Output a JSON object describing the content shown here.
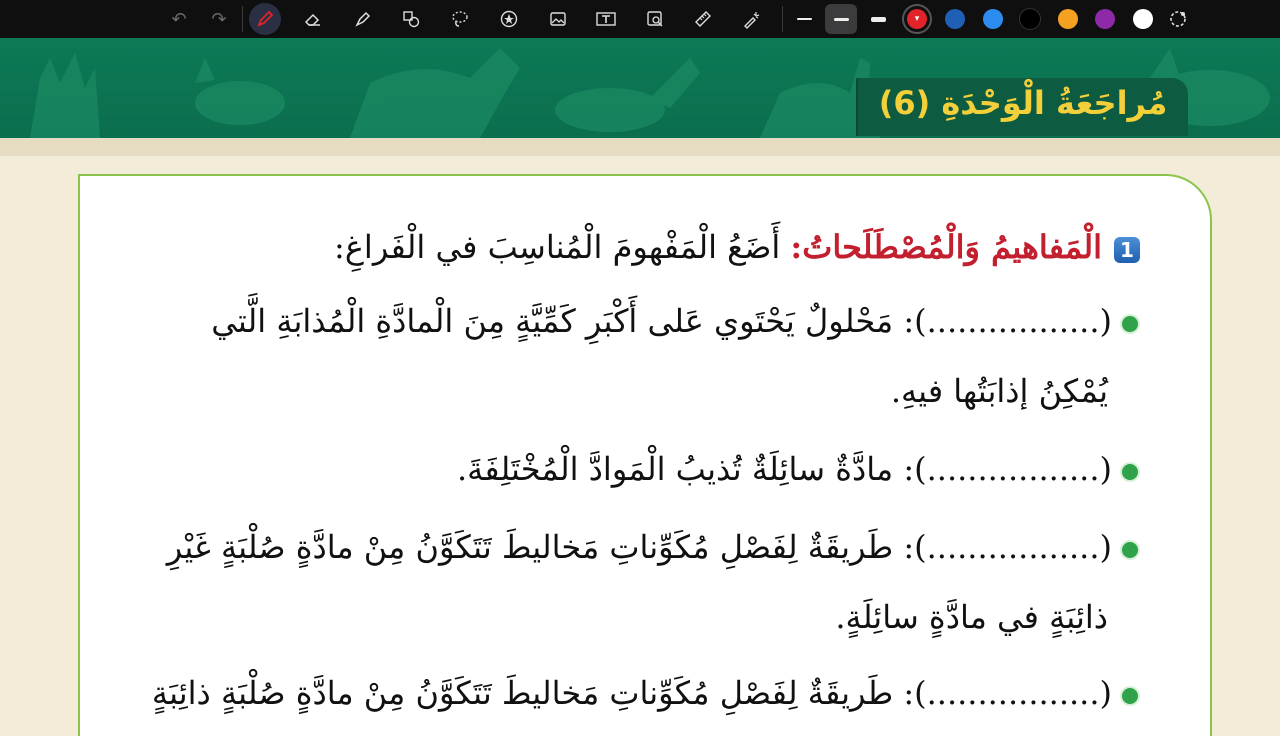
{
  "toolbar": {
    "tools": [
      "undo-icon",
      "redo-icon",
      "pen-icon",
      "eraser-icon",
      "highlighter-icon",
      "shapes-icon",
      "lasso-icon",
      "sticker-icon",
      "image-icon",
      "text-box-icon",
      "image-search-icon",
      "ruler-icon",
      "laser-pointer-icon"
    ],
    "thickness": [
      "thin",
      "medium",
      "thick"
    ],
    "selected_thickness": "medium",
    "colors": [
      "#e0242a",
      "#1f5fb5",
      "#2d8cf0",
      "#000000",
      "#f4a020",
      "#8e2aa8",
      "#ffffff"
    ],
    "selected_color": "#e0242a"
  },
  "banner": {
    "title": "مُراجَعَةُ الْوَحْدَةِ (6)"
  },
  "section": {
    "number": "1",
    "heading_red": "الْمَفاهيمُ وَالْمُصْطَلَحاتُ:",
    "heading_rest": " أَضَعُ الْمَفْهومَ الْمُناسِبَ في الْفَراغِ:"
  },
  "items": [
    {
      "line1": "(.................): مَحْلولٌ يَحْتَوي عَلى أَكْبَرِ كَمِّيَّةٍ مِنَ الْمادَّةِ الْمُذابَةِ الَّتي",
      "line2": "يُمْكِنُ إذابَتُها فيهِ."
    },
    {
      "line1": "(.................): مادَّةٌ سائِلَةٌ تُذيبُ الْمَوادَّ الْمُخْتَلِفَةَ."
    },
    {
      "line1": "(.................): طَريقَةٌ لِفَصْلِ مُكَوِّناتِ مَخاليطَ تَتَكَوَّنُ مِنْ مادَّةٍ صُلْبَةٍ غَيْرِ",
      "line2": "ذائِبَةٍ في مادَّةٍ سائِلَةٍ."
    },
    {
      "line1": "(.................): طَريقَةٌ لِفَصْلِ مُكَوِّناتِ مَخاليطَ تَتَكَوَّنُ مِنْ مادَّةٍ صُلْبَةٍ ذائِبَةٍ"
    }
  ]
}
